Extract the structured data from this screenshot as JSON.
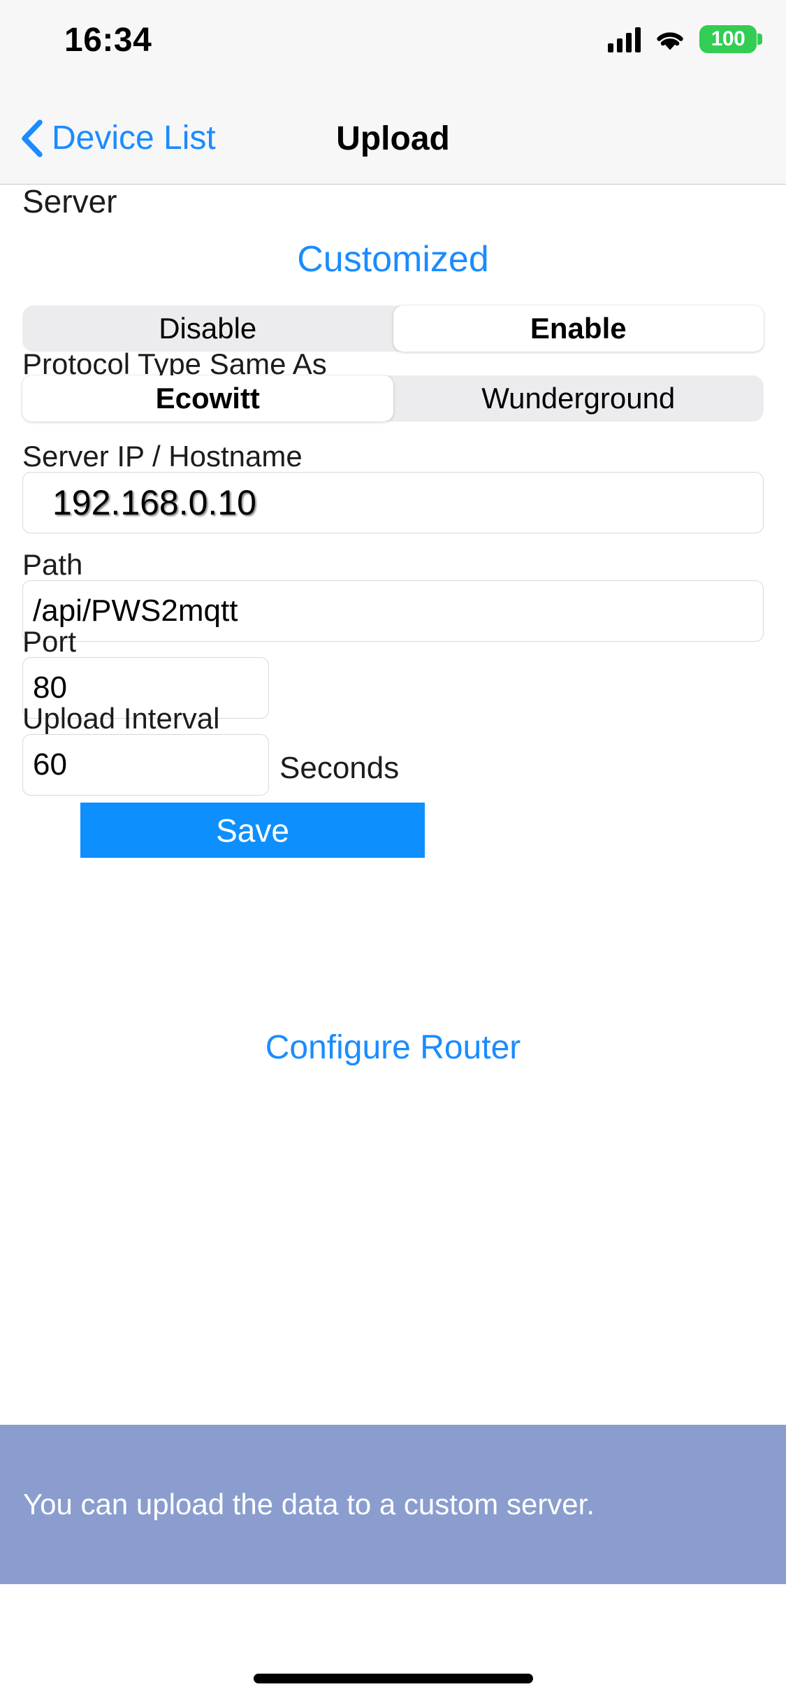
{
  "status_bar": {
    "time": "16:34",
    "cellular_icon": "cellular-signal-icon",
    "wifi_icon": "wifi-icon",
    "battery_level": "100",
    "battery_color": "#32cd53"
  },
  "nav": {
    "back_icon": "chevron-left-icon",
    "back_label": "Device List",
    "title": "Upload"
  },
  "theme": {
    "accent_blue": "#1a8cff",
    "save_blue": "#0d90fd",
    "toast_overlay": "#7f93c2",
    "segment_track": "#ececee"
  },
  "form": {
    "section_label": "Server",
    "server_name": "Customized",
    "power_segment": {
      "name": "enable-disable-segment",
      "options": [
        "Disable",
        "Enable"
      ],
      "selected": "Enable",
      "selected_index": 1
    },
    "protocol_label": "Protocol Type Same As",
    "protocol_segment": {
      "name": "protocol-type-segment",
      "options": [
        "Ecowitt",
        "Wunderground"
      ],
      "selected": "Ecowitt",
      "selected_index": 0
    },
    "fields": [
      {
        "label": "Server IP / Hostname",
        "value": "192.168.0.10"
      },
      {
        "label": "Path",
        "value": "/api/PWS2mqtt"
      },
      {
        "label": "Port",
        "value": "80"
      },
      {
        "label": "Upload Interval",
        "value": "60",
        "unit": "Seconds"
      }
    ],
    "save_label": "Save"
  },
  "footer": {
    "configure_router_label": "Configure Router"
  },
  "toast": {
    "message": "You can upload the data to a custom server."
  }
}
